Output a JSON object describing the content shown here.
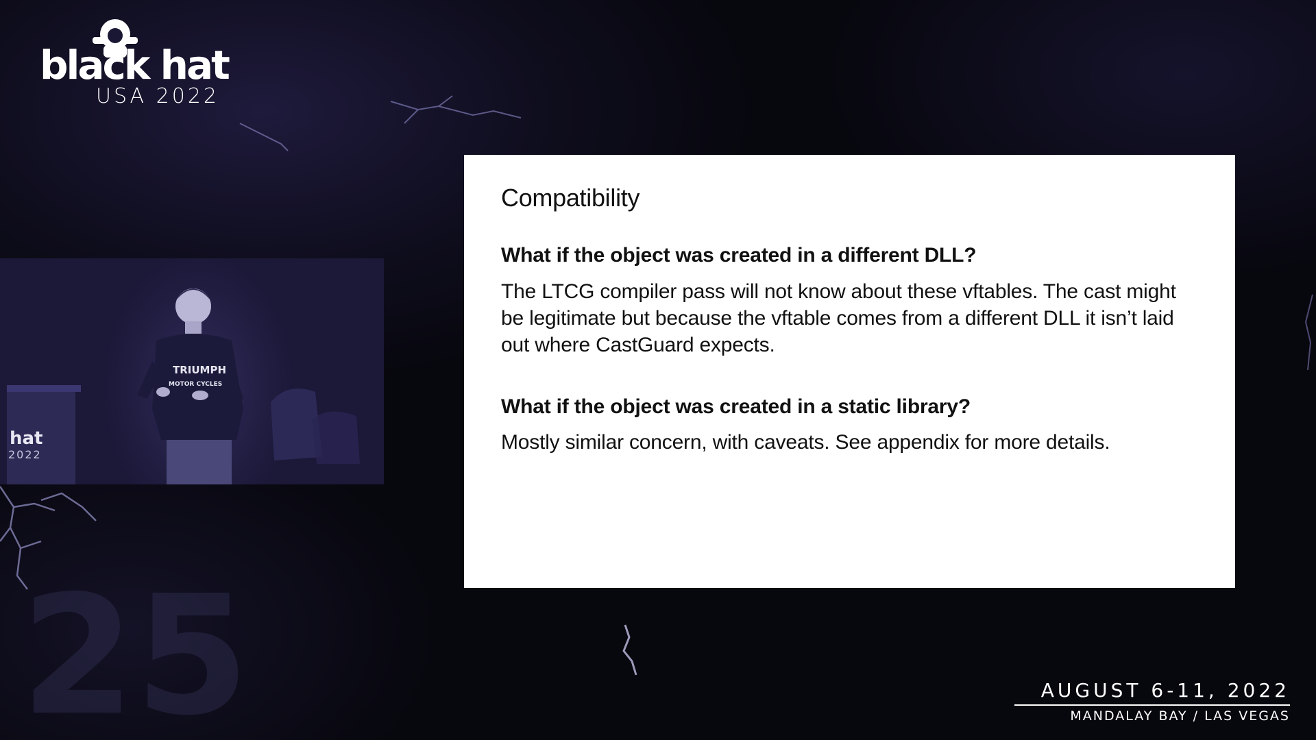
{
  "branding": {
    "logo_word": "black hat",
    "logo_sub": "USA 2022",
    "podium_word": "hat",
    "podium_sub": "2022",
    "anniversary_mark": "25"
  },
  "speaker_shirt": {
    "line1": "TRIUMPH",
    "line2": "MOTOR CYCLES"
  },
  "slide": {
    "title": "Compatibility",
    "sections": [
      {
        "question": "What if the object was created in a different DLL?",
        "answer": "The LTCG compiler pass will not know about these vftables. The cast might be legitimate but because the vftable comes from a different DLL it isn’t laid out where CastGuard expects."
      },
      {
        "question": "What if the object was created in a static library?",
        "answer": "Mostly similar concern, with caveats. See appendix for more details."
      }
    ]
  },
  "event": {
    "dates": "AUGUST 6-11, 2022",
    "venue": "MANDALAY BAY / LAS VEGAS"
  },
  "colors": {
    "background": "#07070e",
    "purple_tint": "#2a2650",
    "slide_background": "#ffffff",
    "text": "#111111",
    "lightning": "#9d9cc8"
  }
}
